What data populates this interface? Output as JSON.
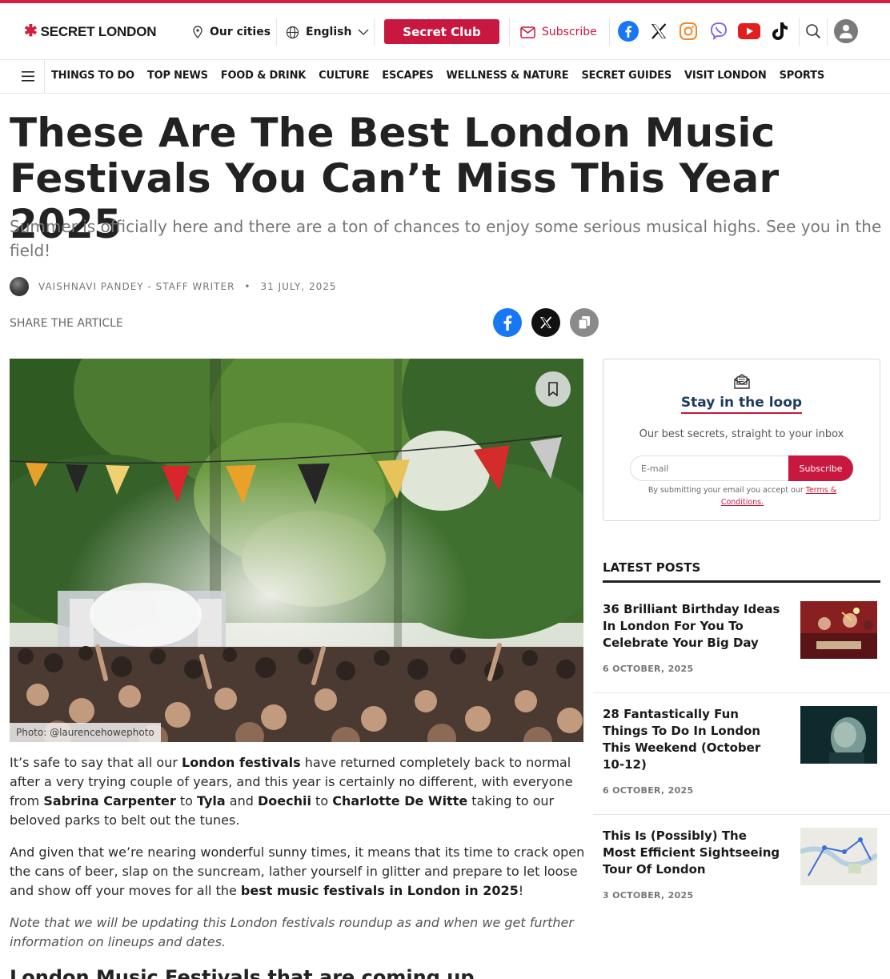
{
  "header": {
    "logo_text": "SECRET LONDON",
    "cities_label": "Our cities",
    "language_label": "English",
    "club_label": "Secret Club",
    "subscribe_label": "Subscribe",
    "social_icons": [
      "facebook-icon",
      "x-icon",
      "instagram-icon",
      "viber-icon",
      "youtube-icon",
      "tiktok-icon"
    ],
    "colors": {
      "accent": "#c8183f",
      "facebook": "#1877f2"
    }
  },
  "nav": {
    "items": [
      "THINGS TO DO",
      "TOP NEWS",
      "FOOD & DRINK",
      "CULTURE",
      "ESCAPES",
      "WELLNESS & NATURE",
      "SECRET GUIDES",
      "VISIT LONDON",
      "SPORTS"
    ]
  },
  "article": {
    "title": "These Are The Best London Music Festivals You Can’t Miss This Year 2025",
    "subtitle": "Summer is officially here and there are a ton of chances to enjoy some serious musical highs. See you in the field!",
    "author": "VAISHNAVI PANDEY - STAFF WRITER",
    "date": "31 JULY, 2025",
    "share_label": "SHARE THE ARTICLE",
    "photo_caption": "Photo: @laurencehowephoto",
    "p1": {
      "t1": "It’s safe to say that all our ",
      "b1": "London festivals",
      "t2": " have returned completely back to normal after a very trying couple of years, and this year is certainly no different, with everyone from ",
      "b2": "Sabrina Carpenter",
      "t3": " to ",
      "b3": "Tyla",
      "t4": " and ",
      "b4": "Doechii",
      "t5": " to ",
      "b5": "Charlotte De Witte",
      "t6": " taking to our beloved parks to belt out the tunes."
    },
    "p2": {
      "t1": "And given that we’re nearing wonderful sunny times, it means that its time to crack open the cans of beer, slap on the suncream, lather yourself in glitter and prepare to let loose and show off your moves for all the ",
      "b1": "best music festivals in London in 2025",
      "t2": "!"
    },
    "p3": "Note that we will be updating this London festivals roundup as and when we get further information on lineups and dates.",
    "h2": "London Music Festivals that are coming up"
  },
  "newsletter": {
    "title": "Stay in the loop",
    "subtitle": "Our best secrets, straight to your inbox",
    "email_placeholder": "E-mail",
    "button": "Subscribe",
    "terms_text": "By submitting your email you accept our ",
    "terms_link": "Terms & Conditions."
  },
  "latest": {
    "heading": "LATEST POSTS",
    "posts": [
      {
        "title": "36 Brilliant Birthday Ideas In London For You To Celebrate Your Big Day",
        "date": "6 OCTOBER, 2025"
      },
      {
        "title": "28 Fantastically Fun Things To Do In London This Weekend (October 10-12)",
        "date": "6 OCTOBER, 2025"
      },
      {
        "title": "This Is (Possibly) The Most Efficient Sightseeing Tour Of London",
        "date": "3 OCTOBER, 2025"
      }
    ]
  }
}
